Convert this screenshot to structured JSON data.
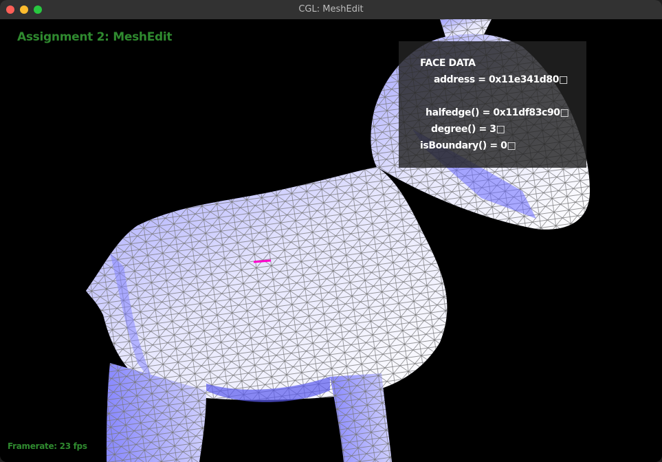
{
  "window": {
    "title": "CGL: MeshEdit"
  },
  "hud": {
    "title": "Assignment 2: MeshEdit",
    "framerate": "Framerate: 23 fps"
  },
  "face_data": {
    "header": "FACE DATA",
    "address": "address = 0x11e341d80□",
    "halfedge": "halfedge() = 0x11df83c90□",
    "degree": "degree() = 3□",
    "is_boundary": "isBoundary() = 0□"
  },
  "colors": {
    "hud_text": "#2f8a2f",
    "mesh_fill": "#c8c8ff",
    "selected_edge": "#ff00cc"
  }
}
